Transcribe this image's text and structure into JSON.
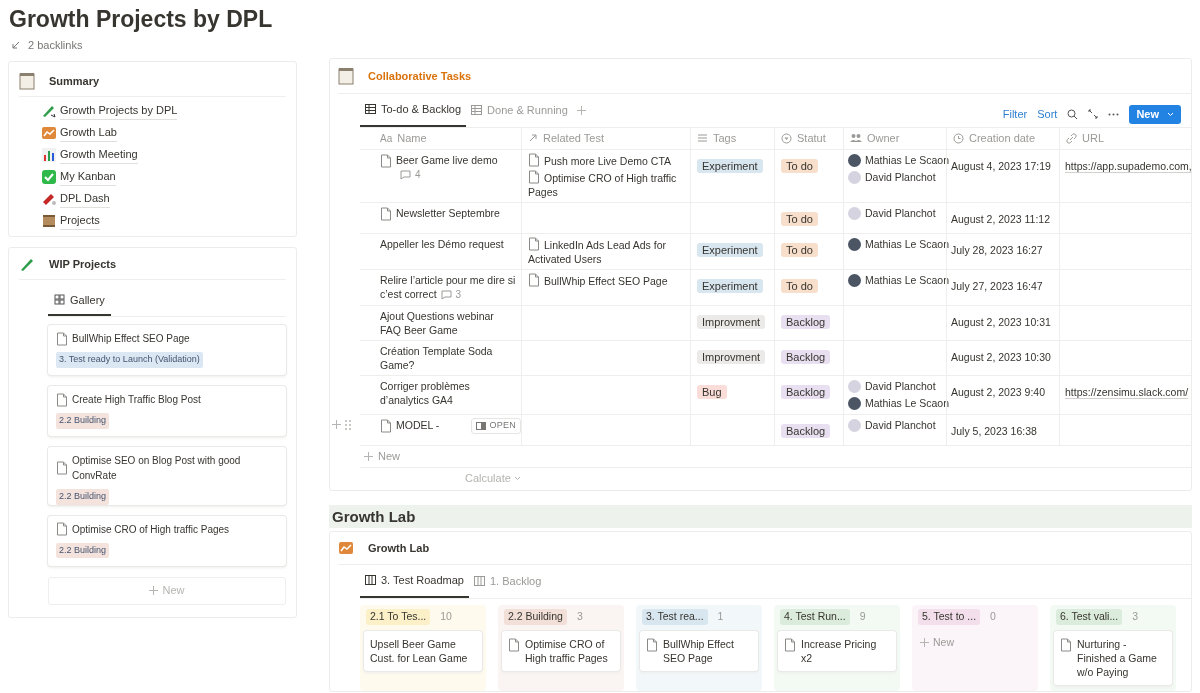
{
  "page": {
    "title": "Growth Projects by DPL",
    "backlinks": "2 backlinks"
  },
  "summary": {
    "title": "Summary",
    "links": [
      {
        "label": "Growth Projects by DPL"
      },
      {
        "label": "Growth Lab"
      },
      {
        "label": "Growth Meeting"
      },
      {
        "label": "My Kanban"
      },
      {
        "label": "DPL Dash"
      },
      {
        "label": "Projects"
      }
    ]
  },
  "wip": {
    "title": "WIP Projects",
    "tabs": [
      {
        "label": "Gallery",
        "selected": true
      }
    ],
    "cards": [
      {
        "title": "BullWhip Effect SEO Page",
        "tag": "3. Test ready to Launch (Validation)",
        "color": "#dbe8f3"
      },
      {
        "title": "Create High Traffic Blog Post",
        "tag": "2.2 Building",
        "color": "#f4e3dd"
      },
      {
        "title": "Optimise SEO on Blog Post with good ConvRate",
        "tag": "2.2 Building",
        "color": "#f4e3dd"
      },
      {
        "title": "Optimise CRO of High traffic Pages",
        "tag": "2.2 Building",
        "color": "#f4e3dd"
      }
    ],
    "new": "New"
  },
  "tasks": {
    "title": "Collaborative Tasks",
    "tabs": [
      {
        "label": "To-do & Backlog",
        "selected": true
      },
      {
        "label": "Done & Running",
        "selected": false
      }
    ],
    "actions": {
      "filter": "Filter",
      "sort": "Sort",
      "new": "New"
    },
    "name_icon": "Aa",
    "columns": [
      "Name",
      "Related Test",
      "Tags",
      "Statut",
      "Owner",
      "Creation date",
      "URL"
    ],
    "rows": [
      {
        "kind": "page",
        "name": "Beer Game live demo",
        "comments": "4",
        "related": [
          "Push more Live Demo CTA",
          "Optimise CRO of High traffic Pages"
        ],
        "tag": {
          "label": "Experiment",
          "color": "#d8e6f0"
        },
        "status": {
          "label": "To do",
          "color": "#f8dfcc"
        },
        "owners": [
          {
            "name": "Mathias Le Scaon",
            "color": "#4b5563"
          },
          {
            "name": "David Planchot",
            "color": "#d6d3e0"
          }
        ],
        "date": "August 4, 2023 17:19",
        "url": "https://app.supademo.com,"
      },
      {
        "kind": "page",
        "name": "Newsletter Septembre",
        "related": [],
        "status": {
          "label": "To do",
          "color": "#f8dfcc"
        },
        "owners": [
          {
            "name": "David Planchot",
            "color": "#d6d3e0"
          }
        ],
        "date": "August 2, 2023 11:12"
      },
      {
        "kind": "plain",
        "name": "Appeller les Démo request",
        "related": [
          "LinkedIn Ads Lead Ads for Activated Users"
        ],
        "tag": {
          "label": "Experiment",
          "color": "#d8e6f0"
        },
        "status": {
          "label": "To do",
          "color": "#f8dfcc"
        },
        "owners": [
          {
            "name": "Mathias Le Scaon",
            "color": "#4b5563"
          }
        ],
        "date": "July 28, 2023 16:27"
      },
      {
        "kind": "plain",
        "name": "Relire l’article pour me dire si c’est correct",
        "comments": "3",
        "related": [
          "BullWhip Effect SEO Page"
        ],
        "tag": {
          "label": "Experiment",
          "color": "#d8e6f0"
        },
        "status": {
          "label": "To do",
          "color": "#f8dfcc"
        },
        "owners": [
          {
            "name": "Mathias Le Scaon",
            "color": "#4b5563"
          }
        ],
        "date": "July 27, 2023 16:47"
      },
      {
        "kind": "plain",
        "name": "Ajout Questions webinar FAQ Beer Game",
        "related": [],
        "tag": {
          "label": "Improvment",
          "color": "#ebeae8"
        },
        "status": {
          "label": "Backlog",
          "color": "#e8e0f0"
        },
        "owners": [],
        "date": "August 2, 2023 10:31"
      },
      {
        "kind": "plain",
        "name": "Création Template Soda Game?",
        "related": [],
        "tag": {
          "label": "Improvment",
          "color": "#ebeae8"
        },
        "status": {
          "label": "Backlog",
          "color": "#e8e0f0"
        },
        "owners": [],
        "date": "August 2, 2023 10:30"
      },
      {
        "kind": "plain",
        "name": "Corriger problèmes d’analytics GA4",
        "related": [],
        "tag": {
          "label": "Bug",
          "color": "#fadcd8"
        },
        "status": {
          "label": "Backlog",
          "color": "#e8e0f0"
        },
        "owners": [
          {
            "name": "David Planchot",
            "color": "#d6d3e0"
          },
          {
            "name": "Mathias Le Scaon",
            "color": "#4b5563"
          }
        ],
        "date": "August 2, 2023 9:40",
        "url": "https://zensimu.slack.com/"
      },
      {
        "kind": "page",
        "name": "MODEL -",
        "open": "OPEN",
        "related": [],
        "status": {
          "label": "Backlog",
          "color": "#e8e0f0"
        },
        "owners": [
          {
            "name": "David Planchot",
            "color": "#d6d3e0"
          }
        ],
        "date": "July 5, 2023 16:38"
      }
    ],
    "new": "New",
    "calculate": "Calculate"
  },
  "lab": {
    "heading": "Growth Lab",
    "title": "Growth Lab",
    "tabs": [
      {
        "label": "3. Test Roadmap",
        "selected": true
      },
      {
        "label": "1. Backlog",
        "selected": false
      }
    ],
    "columns": [
      {
        "label": "2.1 To Tes...",
        "count": "10",
        "color": "#fbf0c8",
        "cards": [
          {
            "kind": "plain",
            "title": "Upsell Beer Game Cust. for Lean Game"
          }
        ]
      },
      {
        "label": "2.2 Building",
        "count": "3",
        "color": "#f1dfd8",
        "cards": [
          {
            "kind": "page",
            "title": "Optimise CRO of High traffic Pages"
          }
        ]
      },
      {
        "label": "3. Test rea...",
        "count": "1",
        "color": "#d8e6f0",
        "cards": [
          {
            "kind": "page",
            "title": "BullWhip Effect SEO Page"
          }
        ]
      },
      {
        "label": "4. Test Run...",
        "count": "9",
        "color": "#dcecdc",
        "cards": [
          {
            "kind": "page",
            "title": "Increase Pricing x2"
          }
        ]
      },
      {
        "label": "5. Test to ...",
        "count": "0",
        "color": "#f3dfec",
        "new": "New"
      },
      {
        "label": "6. Test vali...",
        "count": "3",
        "color": "#dcecdc",
        "cards": [
          {
            "kind": "page",
            "title": "Nurturing - Finished a Game w/o Paying"
          }
        ]
      }
    ]
  }
}
